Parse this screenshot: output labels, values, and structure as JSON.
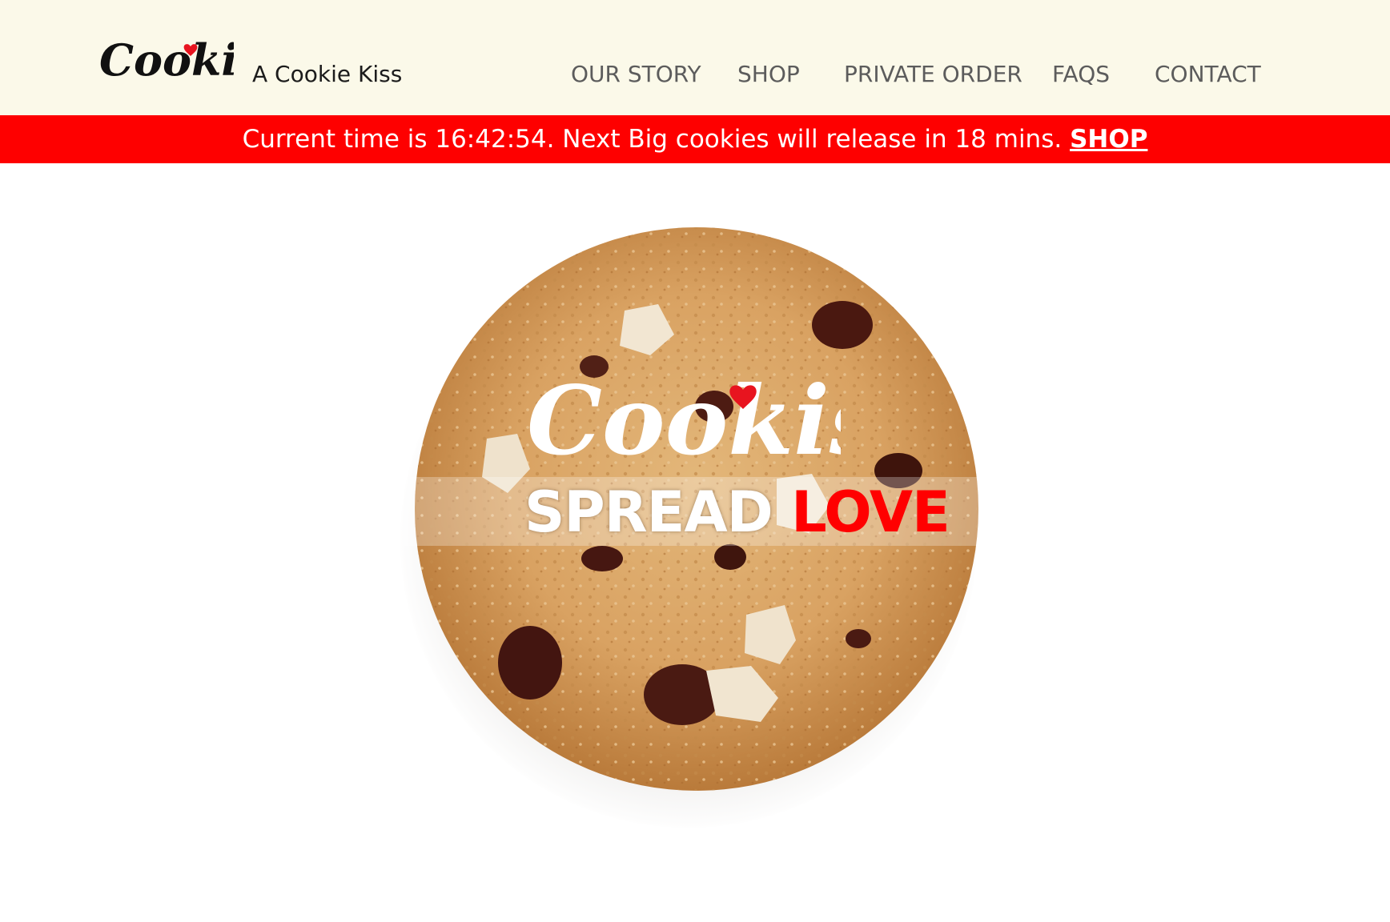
{
  "header": {
    "logo_text": "Cookiss",
    "tagline": "A Cookie Kiss",
    "nav": [
      {
        "label": "OUR STORY"
      },
      {
        "label": "SHOP"
      },
      {
        "label": "PRIVATE ORDER"
      },
      {
        "label": "FAQS"
      },
      {
        "label": "CONTACT"
      }
    ]
  },
  "banner": {
    "message": "Current time is 16:42:54. Next Big cookies will release in 18 mins.",
    "link_label": "SHOP"
  },
  "hero": {
    "logo_text": "Cookiss",
    "slogan_word1": "SPREAD",
    "slogan_word2": "LOVE"
  },
  "colors": {
    "header_bg": "#fbf9e9",
    "banner_bg": "#fe0000",
    "accent_red": "#ff0000",
    "nav_text": "#5c5c5c"
  },
  "icons": {
    "logo_heart": "heart-icon"
  }
}
